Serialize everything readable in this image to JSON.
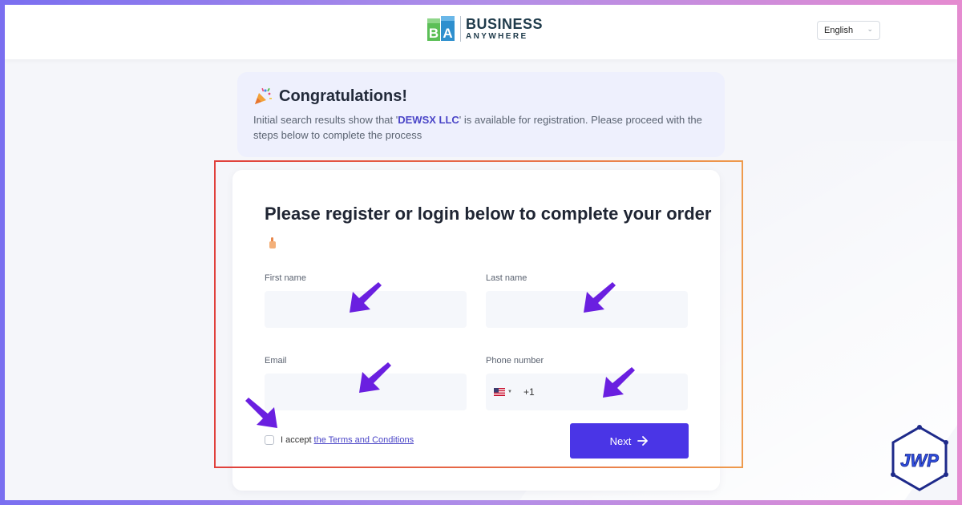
{
  "header": {
    "logo_line1": "BUSINESS",
    "logo_line2": "ANYWHERE",
    "language": "English"
  },
  "congrats": {
    "title": "Congratulations!",
    "text_before": "Initial search results show that '",
    "company": "DEWSX LLC",
    "text_after": "' is available for registration. Please proceed with the steps below to complete the process"
  },
  "form": {
    "title": "Please register or login below to complete your order",
    "first_name_label": "First name",
    "last_name_label": "Last name",
    "email_label": "Email",
    "phone_label": "Phone number",
    "phone_prefix": "+1",
    "terms_prefix": "I accept",
    "terms_link": "the Terms and Conditions",
    "next_label": "Next"
  },
  "watermark": {
    "text": "JWP"
  },
  "colors": {
    "accent": "#4a35e6",
    "arrow": "#6a1fe0",
    "highlight": "#e0403b"
  }
}
